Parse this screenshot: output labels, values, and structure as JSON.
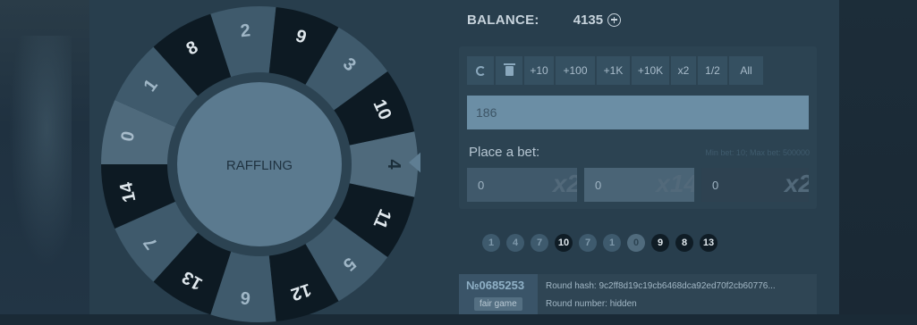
{
  "balance": {
    "label": "BALANCE:",
    "value": "4135"
  },
  "wheel": {
    "center_label": "RAFFLING",
    "segments": [
      {
        "n": "4",
        "color": "#4f6a7c",
        "text": "#1b2e3a"
      },
      {
        "n": "11",
        "color": "#0d1a23",
        "text": "#dfe7ec"
      },
      {
        "n": "5",
        "color": "#3f5a6c",
        "text": "#9fb6c6"
      },
      {
        "n": "12",
        "color": "#0d1a23",
        "text": "#dfe7ec"
      },
      {
        "n": "6",
        "color": "#3f5a6c",
        "text": "#9fb6c6"
      },
      {
        "n": "13",
        "color": "#0d1a23",
        "text": "#dfe7ec"
      },
      {
        "n": "7",
        "color": "#3f5a6c",
        "text": "#9fb6c6"
      },
      {
        "n": "14",
        "color": "#0d1a23",
        "text": "#dfe7ec"
      },
      {
        "n": "0",
        "color": "#4f6a7c",
        "text": "#a8bccb"
      },
      {
        "n": "1",
        "color": "#3f5a6c",
        "text": "#9fb6c6"
      },
      {
        "n": "8",
        "color": "#0d1a23",
        "text": "#dfe7ec"
      },
      {
        "n": "2",
        "color": "#3f5a6c",
        "text": "#9fb6c6"
      },
      {
        "n": "9",
        "color": "#0d1a23",
        "text": "#dfe7ec"
      },
      {
        "n": "3",
        "color": "#3f5a6c",
        "text": "#9fb6c6"
      },
      {
        "n": "10",
        "color": "#0d1a23",
        "text": "#dfe7ec"
      }
    ]
  },
  "toolbar": {
    "refresh_icon": "refresh-icon",
    "clear_icon": "trash-icon",
    "b10": "+10",
    "b100": "+100",
    "b1k": "+1K",
    "b10k": "+10K",
    "x2": "x2",
    "half": "1/2",
    "all": "All"
  },
  "bet_input": {
    "value": "186"
  },
  "place_bet": {
    "label": "Place a bet:",
    "limits": "Min bet: 10; Max bet: 500000"
  },
  "bets": [
    {
      "amount": "0",
      "mult": "x2"
    },
    {
      "amount": "0",
      "mult": "x14"
    },
    {
      "amount": "0",
      "mult": "x2"
    }
  ],
  "history": [
    {
      "n": "1",
      "type": "red"
    },
    {
      "n": "4",
      "type": "red"
    },
    {
      "n": "7",
      "type": "red"
    },
    {
      "n": "10",
      "type": "black"
    },
    {
      "n": "7",
      "type": "red"
    },
    {
      "n": "1",
      "type": "red"
    },
    {
      "n": "0",
      "type": "green"
    },
    {
      "n": "9",
      "type": "black"
    },
    {
      "n": "8",
      "type": "black"
    },
    {
      "n": "13",
      "type": "black"
    }
  ],
  "round": {
    "number": "№0685253",
    "fair_label": "fair game",
    "hash": "Round hash: 9c2ff8d19c19cb6468dca92ed70f2cb60776...",
    "round_number": "Round number: hidden"
  }
}
